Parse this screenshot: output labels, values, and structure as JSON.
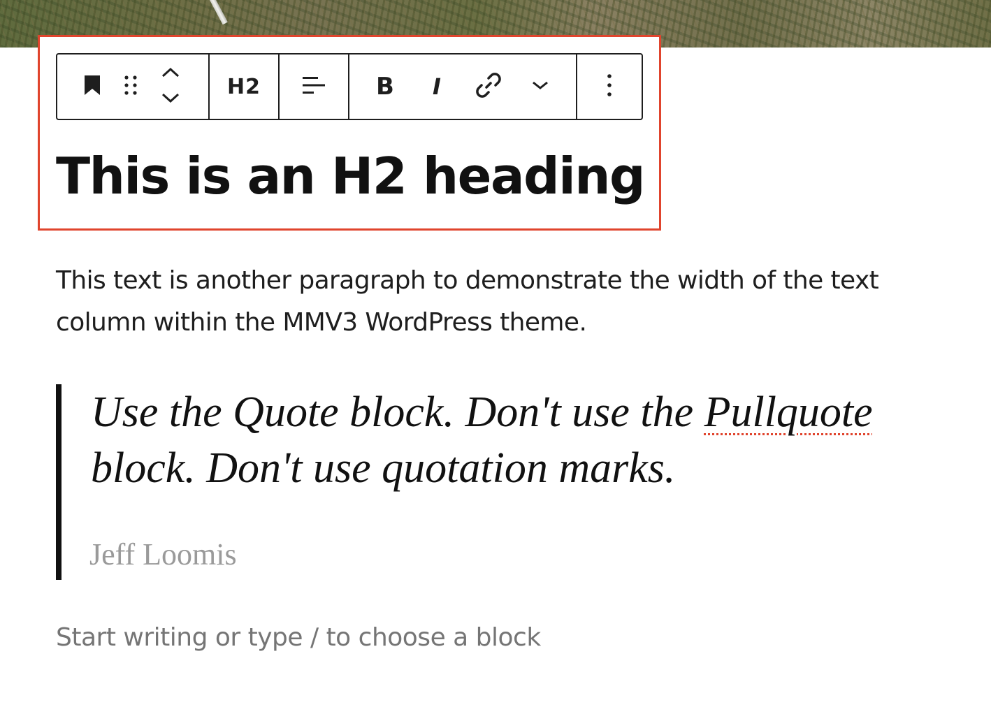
{
  "toolbar": {
    "block_icon": "bookmark-icon",
    "drag_icon": "drag-handle-icon",
    "move_icon": "move-up-down-icon",
    "heading_level_label": "H2",
    "align_icon": "align-left-icon",
    "bold_label": "B",
    "italic_label": "I",
    "link_icon": "link-icon",
    "more_formats_icon": "chevron-down-icon",
    "options_icon": "more-vertical-icon"
  },
  "content": {
    "heading": "This is an H2 heading",
    "paragraph": "This text is another paragraph to demonstrate the width of the text column within the MMV3 WordPress theme.",
    "quote": {
      "text_before": "Use the Quote block. Don't use the ",
      "misspelled_word": "Pullquote",
      "text_after": " block. Don't use quotation marks.",
      "citation": "Jeff Loomis"
    },
    "placeholder": "Start writing or type / to choose a block"
  },
  "colors": {
    "selection_outline": "#e0442d",
    "text": "#111111",
    "citation": "#9a9a9a",
    "placeholder": "#757575"
  }
}
